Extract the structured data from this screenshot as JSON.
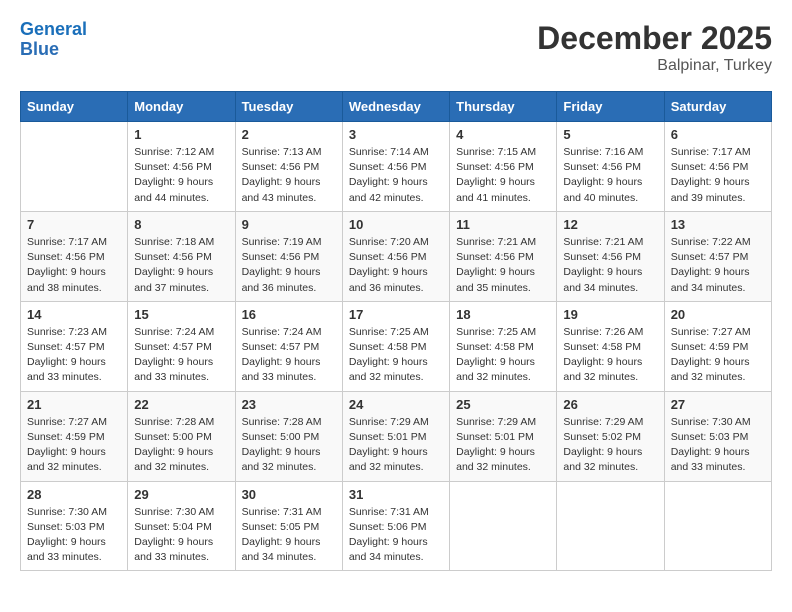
{
  "header": {
    "logo_general": "General",
    "logo_blue": "Blue",
    "month_title": "December 2025",
    "location": "Balpinar, Turkey"
  },
  "days_of_week": [
    "Sunday",
    "Monday",
    "Tuesday",
    "Wednesday",
    "Thursday",
    "Friday",
    "Saturday"
  ],
  "weeks": [
    [
      {
        "day": "",
        "info": ""
      },
      {
        "day": "1",
        "info": "Sunrise: 7:12 AM\nSunset: 4:56 PM\nDaylight: 9 hours\nand 44 minutes."
      },
      {
        "day": "2",
        "info": "Sunrise: 7:13 AM\nSunset: 4:56 PM\nDaylight: 9 hours\nand 43 minutes."
      },
      {
        "day": "3",
        "info": "Sunrise: 7:14 AM\nSunset: 4:56 PM\nDaylight: 9 hours\nand 42 minutes."
      },
      {
        "day": "4",
        "info": "Sunrise: 7:15 AM\nSunset: 4:56 PM\nDaylight: 9 hours\nand 41 minutes."
      },
      {
        "day": "5",
        "info": "Sunrise: 7:16 AM\nSunset: 4:56 PM\nDaylight: 9 hours\nand 40 minutes."
      },
      {
        "day": "6",
        "info": "Sunrise: 7:17 AM\nSunset: 4:56 PM\nDaylight: 9 hours\nand 39 minutes."
      }
    ],
    [
      {
        "day": "7",
        "info": "Sunrise: 7:17 AM\nSunset: 4:56 PM\nDaylight: 9 hours\nand 38 minutes."
      },
      {
        "day": "8",
        "info": "Sunrise: 7:18 AM\nSunset: 4:56 PM\nDaylight: 9 hours\nand 37 minutes."
      },
      {
        "day": "9",
        "info": "Sunrise: 7:19 AM\nSunset: 4:56 PM\nDaylight: 9 hours\nand 36 minutes."
      },
      {
        "day": "10",
        "info": "Sunrise: 7:20 AM\nSunset: 4:56 PM\nDaylight: 9 hours\nand 36 minutes."
      },
      {
        "day": "11",
        "info": "Sunrise: 7:21 AM\nSunset: 4:56 PM\nDaylight: 9 hours\nand 35 minutes."
      },
      {
        "day": "12",
        "info": "Sunrise: 7:21 AM\nSunset: 4:56 PM\nDaylight: 9 hours\nand 34 minutes."
      },
      {
        "day": "13",
        "info": "Sunrise: 7:22 AM\nSunset: 4:57 PM\nDaylight: 9 hours\nand 34 minutes."
      }
    ],
    [
      {
        "day": "14",
        "info": "Sunrise: 7:23 AM\nSunset: 4:57 PM\nDaylight: 9 hours\nand 33 minutes."
      },
      {
        "day": "15",
        "info": "Sunrise: 7:24 AM\nSunset: 4:57 PM\nDaylight: 9 hours\nand 33 minutes."
      },
      {
        "day": "16",
        "info": "Sunrise: 7:24 AM\nSunset: 4:57 PM\nDaylight: 9 hours\nand 33 minutes."
      },
      {
        "day": "17",
        "info": "Sunrise: 7:25 AM\nSunset: 4:58 PM\nDaylight: 9 hours\nand 32 minutes."
      },
      {
        "day": "18",
        "info": "Sunrise: 7:25 AM\nSunset: 4:58 PM\nDaylight: 9 hours\nand 32 minutes."
      },
      {
        "day": "19",
        "info": "Sunrise: 7:26 AM\nSunset: 4:58 PM\nDaylight: 9 hours\nand 32 minutes."
      },
      {
        "day": "20",
        "info": "Sunrise: 7:27 AM\nSunset: 4:59 PM\nDaylight: 9 hours\nand 32 minutes."
      }
    ],
    [
      {
        "day": "21",
        "info": "Sunrise: 7:27 AM\nSunset: 4:59 PM\nDaylight: 9 hours\nand 32 minutes."
      },
      {
        "day": "22",
        "info": "Sunrise: 7:28 AM\nSunset: 5:00 PM\nDaylight: 9 hours\nand 32 minutes."
      },
      {
        "day": "23",
        "info": "Sunrise: 7:28 AM\nSunset: 5:00 PM\nDaylight: 9 hours\nand 32 minutes."
      },
      {
        "day": "24",
        "info": "Sunrise: 7:29 AM\nSunset: 5:01 PM\nDaylight: 9 hours\nand 32 minutes."
      },
      {
        "day": "25",
        "info": "Sunrise: 7:29 AM\nSunset: 5:01 PM\nDaylight: 9 hours\nand 32 minutes."
      },
      {
        "day": "26",
        "info": "Sunrise: 7:29 AM\nSunset: 5:02 PM\nDaylight: 9 hours\nand 32 minutes."
      },
      {
        "day": "27",
        "info": "Sunrise: 7:30 AM\nSunset: 5:03 PM\nDaylight: 9 hours\nand 33 minutes."
      }
    ],
    [
      {
        "day": "28",
        "info": "Sunrise: 7:30 AM\nSunset: 5:03 PM\nDaylight: 9 hours\nand 33 minutes."
      },
      {
        "day": "29",
        "info": "Sunrise: 7:30 AM\nSunset: 5:04 PM\nDaylight: 9 hours\nand 33 minutes."
      },
      {
        "day": "30",
        "info": "Sunrise: 7:31 AM\nSunset: 5:05 PM\nDaylight: 9 hours\nand 34 minutes."
      },
      {
        "day": "31",
        "info": "Sunrise: 7:31 AM\nSunset: 5:06 PM\nDaylight: 9 hours\nand 34 minutes."
      },
      {
        "day": "",
        "info": ""
      },
      {
        "day": "",
        "info": ""
      },
      {
        "day": "",
        "info": ""
      }
    ]
  ]
}
